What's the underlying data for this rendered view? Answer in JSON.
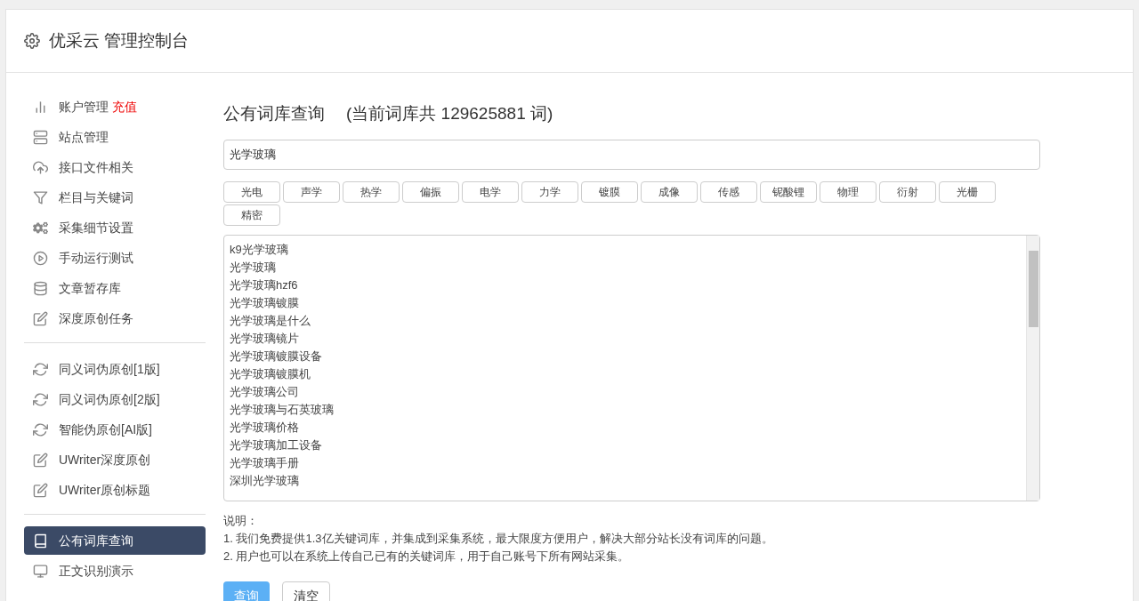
{
  "header": {
    "title": "优采云 管理控制台"
  },
  "sidebar": {
    "groups": [
      {
        "items": [
          {
            "kind": "chart",
            "label": "账户管理",
            "badge": "充值",
            "selected": false
          },
          {
            "kind": "server",
            "label": "站点管理",
            "selected": false
          },
          {
            "kind": "cloud",
            "label": "接口文件相关",
            "selected": false
          },
          {
            "kind": "filter",
            "label": "栏目与关键词",
            "selected": false
          },
          {
            "kind": "gears",
            "label": "采集细节设置",
            "selected": false
          },
          {
            "kind": "play",
            "label": "手动运行测试",
            "selected": false
          },
          {
            "kind": "database",
            "label": "文章暂存库",
            "selected": false
          },
          {
            "kind": "edit",
            "label": "深度原创任务",
            "selected": false
          }
        ]
      },
      {
        "items": [
          {
            "kind": "refresh",
            "label": "同义词伪原创[1版]",
            "selected": false
          },
          {
            "kind": "refresh",
            "label": "同义词伪原创[2版]",
            "selected": false
          },
          {
            "kind": "refresh",
            "label": "智能伪原创[AI版]",
            "selected": false
          },
          {
            "kind": "edit",
            "label": "UWriter深度原创",
            "selected": false
          },
          {
            "kind": "edit",
            "label": "UWriter原创标题",
            "selected": false
          }
        ]
      },
      {
        "items": [
          {
            "kind": "book",
            "label": "公有词库查询",
            "selected": true
          },
          {
            "kind": "monitor",
            "label": "正文识别演示",
            "selected": false
          }
        ]
      }
    ]
  },
  "main": {
    "title": "公有词库查询",
    "subtitle": "(当前词库共 129625881 词)",
    "search": {
      "value": "光学玻璃"
    },
    "tags": [
      "光电",
      "声学",
      "热学",
      "偏振",
      "电学",
      "力学",
      "镀膜",
      "成像",
      "传感",
      "铌酸锂",
      "物理",
      "衍射",
      "光栅",
      "精密"
    ],
    "results": [
      "k9光学玻璃",
      "光学玻璃",
      "光学玻璃hzf6",
      "光学玻璃镀膜",
      "光学玻璃是什么",
      "光学玻璃镜片",
      "光学玻璃镀膜设备",
      "光学玻璃镀膜机",
      "光学玻璃公司",
      "光学玻璃与石英玻璃",
      "光学玻璃价格",
      "光学玻璃加工设备",
      "光学玻璃手册",
      "深圳光学玻璃"
    ],
    "notes_title": "说明：",
    "notes": [
      "1. 我们免费提供1.3亿关键词库，并集成到采集系统，最大限度方便用户，解决大部分站长没有词库的问题。",
      "2. 用户也可以在系统上传自己已有的关键词库，用于自己账号下所有网站采集。"
    ],
    "buttons": [
      {
        "kind": "primary",
        "label": "查询"
      },
      {
        "kind": "default",
        "label": "清空"
      }
    ]
  }
}
